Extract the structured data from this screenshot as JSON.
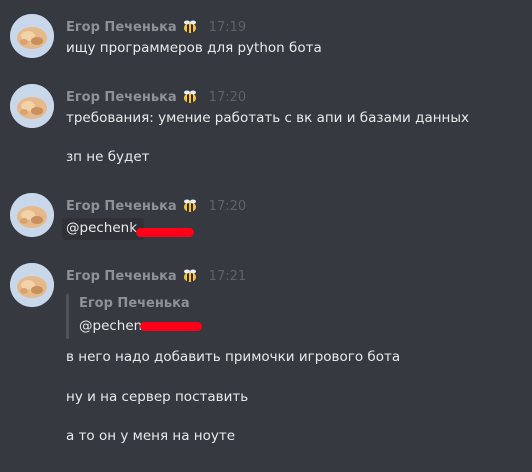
{
  "messages": [
    {
      "author": "Егор Печенька",
      "time": "17:19",
      "lines": [
        "ищу программеров для python бота"
      ]
    },
    {
      "author": "Егор Печенька",
      "time": "17:20",
      "lines": [
        "требования: умение работать с вк апи и базами данных",
        "зп не будет"
      ]
    },
    {
      "author": "Егор Печенька",
      "time": "17:20",
      "mention": "@pechenk"
    },
    {
      "author": "Егор Печенька",
      "time": "17:21",
      "quote": {
        "author": "Егор Печенька",
        "mention": "@pechen"
      },
      "lines": [
        "в него надо добавить примочки игрового бота",
        "ну и на сервер поставить",
        "а то он у меня на ноуте"
      ]
    }
  ],
  "colors": {
    "background": "#36393f",
    "author": "#8e9297",
    "timestamp": "#5f6368",
    "text": "#e9eaeb",
    "redaction": "#ff0018"
  },
  "icons": {
    "avatar": "avatar-image",
    "badge": "bee-icon"
  }
}
